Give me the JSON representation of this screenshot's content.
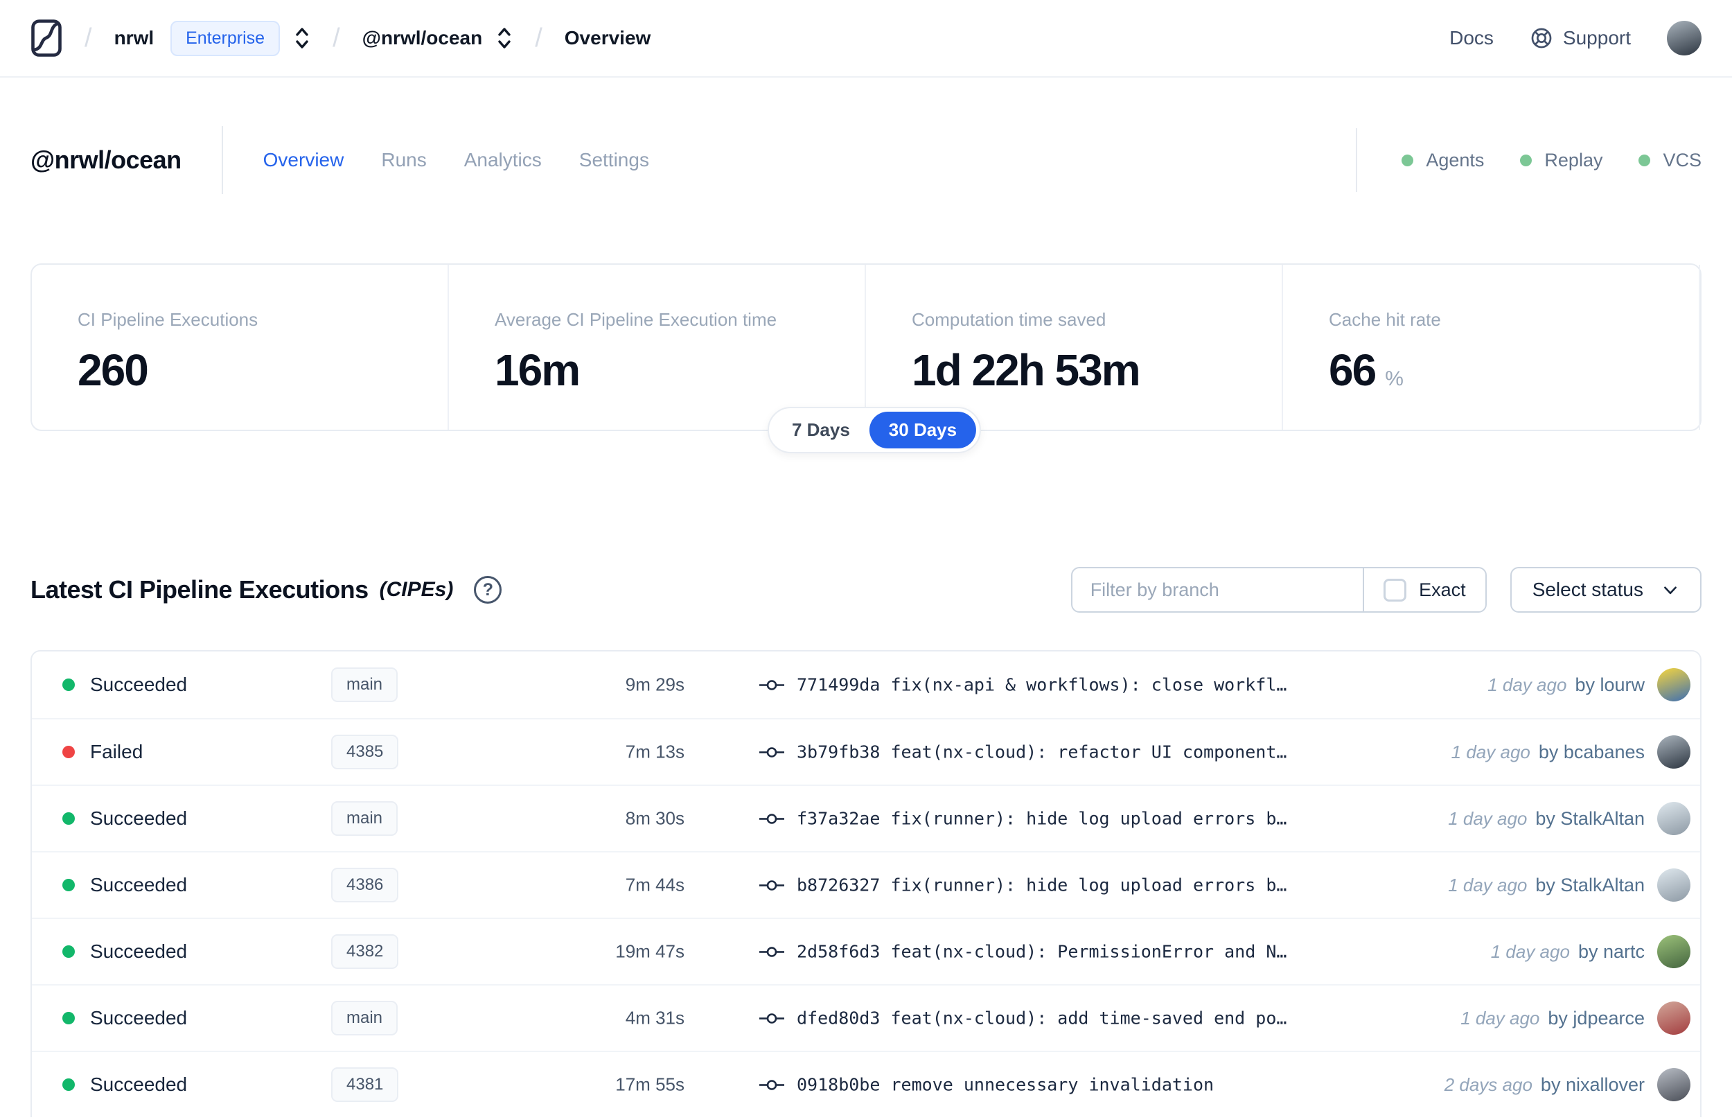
{
  "colors": {
    "accent_blue": "#2563eb",
    "status_green": "#12b76a",
    "status_red": "#ef4444",
    "feature_dot_green": "#7cc795"
  },
  "navbar": {
    "logo": "nx-cloud-logo",
    "breadcrumb": {
      "separator": "/",
      "org": "nrwl",
      "org_badge": "Enterprise",
      "workspace": "@nrwl/ocean",
      "page": "Overview"
    },
    "docs_label": "Docs",
    "support_label": "Support",
    "avatar_colors": [
      "#aab4bd",
      "#2c3540"
    ]
  },
  "workspace_header": {
    "title": "@nrwl/ocean",
    "tabs": [
      {
        "label": "Overview",
        "active": true
      },
      {
        "label": "Runs",
        "active": false
      },
      {
        "label": "Analytics",
        "active": false
      },
      {
        "label": "Settings",
        "active": false
      }
    ],
    "features": [
      {
        "label": "Agents"
      },
      {
        "label": "Replay"
      },
      {
        "label": "VCS"
      }
    ]
  },
  "stats": {
    "cards": [
      {
        "label": "CI Pipeline Executions",
        "value": "260",
        "suffix": ""
      },
      {
        "label": "Average CI Pipeline Execution time",
        "value": "16m",
        "suffix": ""
      },
      {
        "label": "Computation time saved",
        "value": "1d 22h 53m",
        "suffix": ""
      },
      {
        "label": "Cache hit rate",
        "value": "66",
        "suffix": "%"
      }
    ],
    "range_toggle": {
      "options": [
        "7 Days",
        "30 Days"
      ],
      "selected": "30 Days"
    }
  },
  "cipe_section": {
    "title": "Latest CI Pipeline Executions",
    "title_suffix": "(CIPEs)",
    "help_glyph": "?",
    "filter_placeholder": "Filter by branch",
    "exact_label": "Exact",
    "status_dropdown_label": "Select status",
    "rows": [
      {
        "status": "Succeeded",
        "status_color": "green",
        "branch": "main",
        "duration": "9m 29s",
        "commit_hash": "771499da",
        "commit_message": "fix(nx-api & workflows): close workfl…",
        "time_ago": "1 day ago",
        "author": "by lourw",
        "avatar_colors": [
          "#f7d63e",
          "#3e6fb1"
        ]
      },
      {
        "status": "Failed",
        "status_color": "red",
        "branch": "4385",
        "duration": "7m 13s",
        "commit_hash": "3b79fb38",
        "commit_message": "feat(nx-cloud): refactor UI component…",
        "time_ago": "1 day ago",
        "author": "by bcabanes",
        "avatar_colors": [
          "#aab4bd",
          "#2c3540"
        ]
      },
      {
        "status": "Succeeded",
        "status_color": "green",
        "branch": "main",
        "duration": "8m 30s",
        "commit_hash": "f37a32ae",
        "commit_message": "fix(runner): hide log upload errors b…",
        "time_ago": "1 day ago",
        "author": "by StalkAltan",
        "avatar_colors": [
          "#dfe8ee",
          "#8d99a4"
        ]
      },
      {
        "status": "Succeeded",
        "status_color": "green",
        "branch": "4386",
        "duration": "7m 44s",
        "commit_hash": "b8726327",
        "commit_message": "fix(runner): hide log upload errors b…",
        "time_ago": "1 day ago",
        "author": "by StalkAltan",
        "avatar_colors": [
          "#dfe8ee",
          "#8d99a4"
        ]
      },
      {
        "status": "Succeeded",
        "status_color": "green",
        "branch": "4382",
        "duration": "19m 47s",
        "commit_hash": "2d58f6d3",
        "commit_message": "feat(nx-cloud): PermissionError and N…",
        "time_ago": "1 day ago",
        "author": "by nartc",
        "avatar_colors": [
          "#9cc27a",
          "#44653f"
        ]
      },
      {
        "status": "Succeeded",
        "status_color": "green",
        "branch": "main",
        "duration": "4m 31s",
        "commit_hash": "dfed80d3",
        "commit_message": "feat(nx-cloud): add time-saved end po…",
        "time_ago": "1 day ago",
        "author": "by jdpearce",
        "avatar_colors": [
          "#d2a79a",
          "#a33d3f"
        ]
      },
      {
        "status": "Succeeded",
        "status_color": "green",
        "branch": "4381",
        "duration": "17m 55s",
        "commit_hash": "0918b0be",
        "commit_message": "remove unnecessary invalidation",
        "time_ago": "2 days ago",
        "author": "by nixallover",
        "avatar_colors": [
          "#b9bec6",
          "#4a4e57"
        ]
      }
    ]
  }
}
